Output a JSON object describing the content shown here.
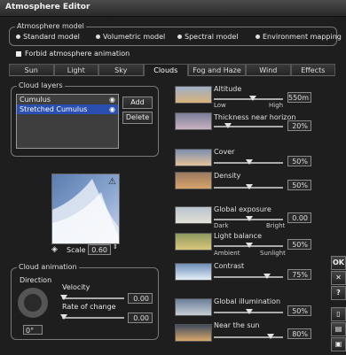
{
  "window": {
    "title": "Atmosphere Editor"
  },
  "atmosphere_model": {
    "label": "Atmosphere model",
    "options": [
      "Standard model",
      "Volumetric model",
      "Spectral model",
      "Environment mapping"
    ],
    "selected": "Standard model"
  },
  "forbid_animation": {
    "label": "Forbid atmosphere animation",
    "checked": true
  },
  "tabs": [
    "Sun",
    "Light",
    "Sky",
    "Clouds",
    "Fog and Haze",
    "Wind",
    "Effects"
  ],
  "active_tab": "Clouds",
  "cloud_layers": {
    "label": "Cloud layers",
    "items": [
      "Cumulus",
      "Stretched Cumulus"
    ],
    "selected": "Stretched Cumulus",
    "add_label": "Add",
    "delete_label": "Delete"
  },
  "preview": {
    "scale_label": "Scale",
    "scale_value": "0.60"
  },
  "cloud_animation": {
    "label": "Cloud animation",
    "direction_label": "Direction",
    "direction_value": "0°",
    "velocity_label": "Velocity",
    "velocity_value": "0.00",
    "rate_label": "Rate of change",
    "rate_value": "0.00"
  },
  "params": {
    "altitude": {
      "label": "Altitude",
      "value": "550m",
      "low": "Low",
      "high": "High"
    },
    "thickness": {
      "label": "Thickness near horizon",
      "value": "20%"
    },
    "cover": {
      "label": "Cover",
      "value": "50%"
    },
    "density": {
      "label": "Density",
      "value": "50%"
    },
    "global_exposure": {
      "label": "Global exposure",
      "value": "0.00",
      "low": "Dark",
      "high": "Bright"
    },
    "light_balance": {
      "label": "Light balance",
      "value": "50%",
      "low": "Ambient",
      "high": "Sunlight"
    },
    "contrast": {
      "label": "Contrast",
      "value": "75%"
    },
    "global_illumination": {
      "label": "Global illumination",
      "value": "50%"
    },
    "near_sun": {
      "label": "Near the sun",
      "value": "80%"
    }
  },
  "side_buttons": {
    "ok": "OK",
    "close": "✕",
    "help": "?"
  }
}
